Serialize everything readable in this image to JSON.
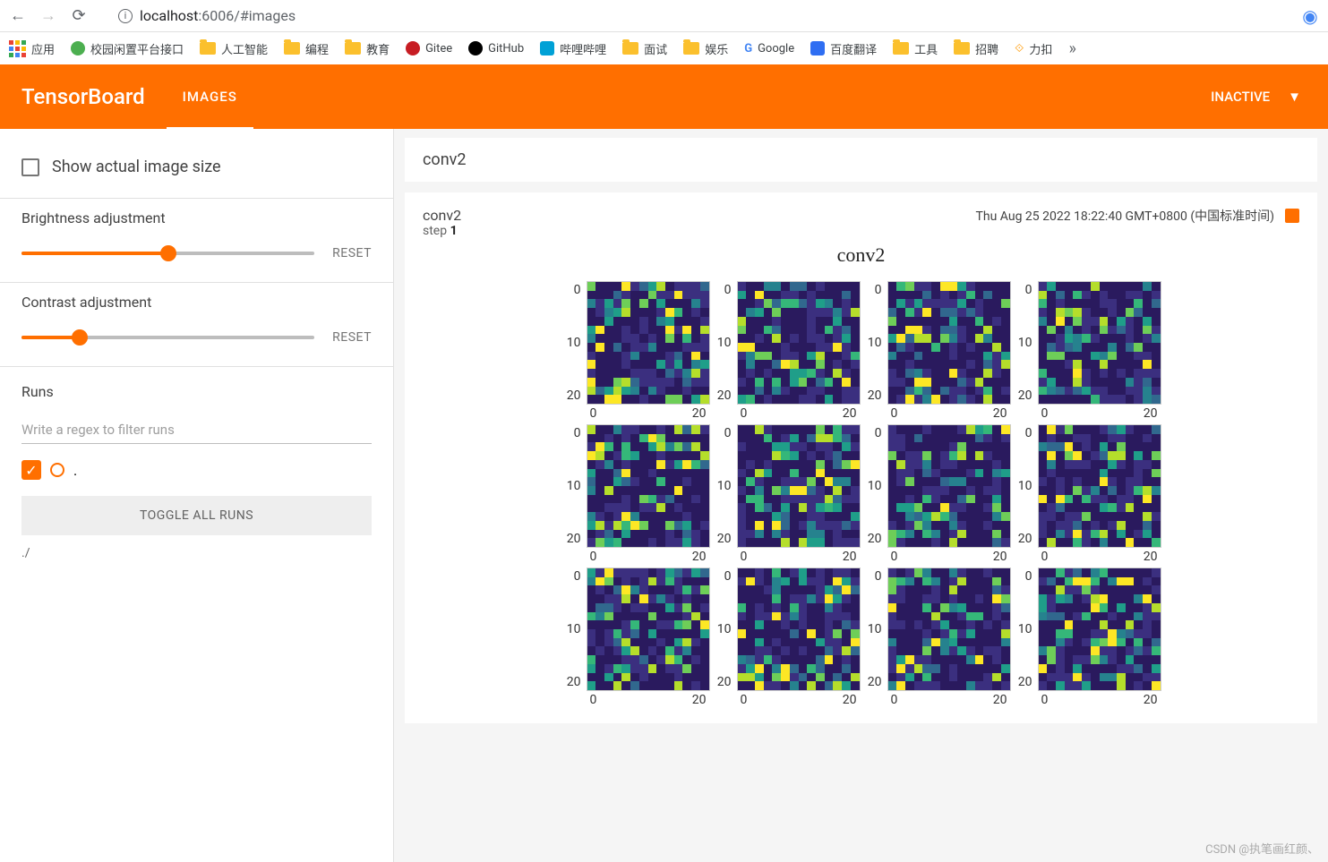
{
  "browser": {
    "url_host": "localhost",
    "url_port": ":6006",
    "url_path": "/#images"
  },
  "bookmarks": {
    "apps": "应用",
    "items": [
      "校园闲置平台接口",
      "人工智能",
      "编程",
      "教育",
      "Gitee",
      "GitHub",
      "哔哩哔哩",
      "面试",
      "娱乐",
      "Google",
      "百度翻译",
      "工具",
      "招聘",
      "力扣"
    ]
  },
  "tensorboard": {
    "logo": "TensorBoard",
    "tab": "IMAGES",
    "inactive": "INACTIVE"
  },
  "sidebar": {
    "show_actual": "Show actual image size",
    "brightness_label": "Brightness adjustment",
    "contrast_label": "Contrast adjustment",
    "reset": "RESET",
    "runs_title": "Runs",
    "runs_placeholder": "Write a regex to filter runs",
    "run_name": ".",
    "toggle_all": "TOGGLE ALL RUNS",
    "run_path": "./",
    "brightness_percent": 50,
    "contrast_percent": 20
  },
  "main": {
    "accordion_title": "conv2",
    "card_title": "conv2",
    "step_label": "step",
    "step_value": "1",
    "timestamp": "Thu Aug 25 2022 18:22:40 GMT+0800 (中国标准时间)",
    "plot_title": "conv2"
  },
  "chart_data": {
    "type": "heatmap",
    "title": "conv2",
    "rows": 3,
    "cols": 4,
    "xlim": [
      0,
      27
    ],
    "ylim": [
      0,
      27
    ],
    "x_ticks": [
      "0",
      "20"
    ],
    "y_ticks": [
      "0",
      "10",
      "20"
    ],
    "note": "3×4 grid of 28×28 convolution feature-map heatmaps (viridis colormap, dark purple low → yellow high). Pixel-level intensities estimated visually; exact values not labeled."
  },
  "watermark": "CSDN @执笔画红颜、"
}
